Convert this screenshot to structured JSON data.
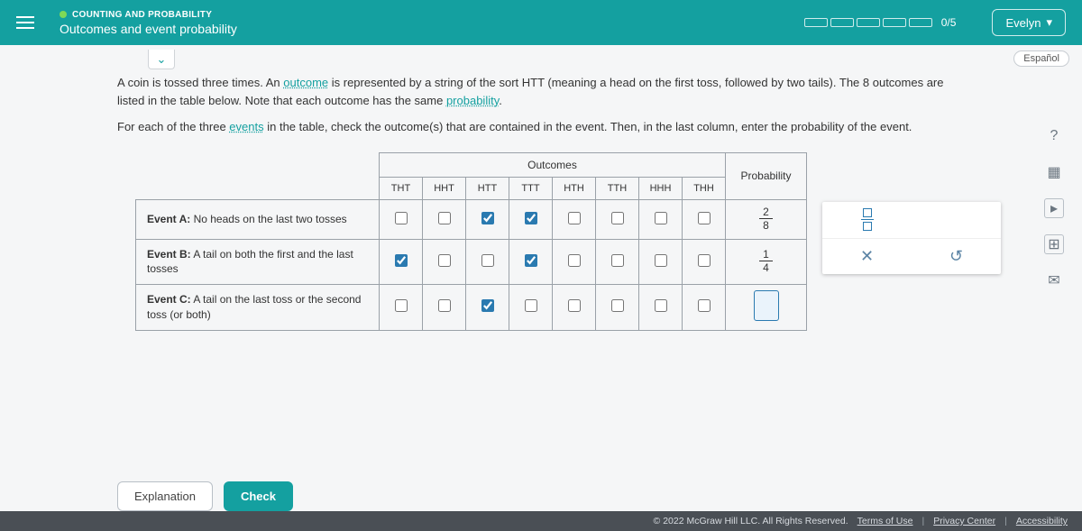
{
  "header": {
    "chapter": "COUNTING AND PROBABILITY",
    "lesson": "Outcomes and event probability",
    "progress": "0/5",
    "user": "Evelyn"
  },
  "toolbar": {
    "language": "Español"
  },
  "question": {
    "p1_a": "A coin is tossed three times. An ",
    "p1_link1": "outcome",
    "p1_b": " is represented by a string of the sort HTT (meaning a head on the first toss, followed by two tails). The 8 outcomes are listed in the table below. Note that each outcome has the same ",
    "p1_link2": "probability",
    "p1_c": ".",
    "p2_a": "For each of the three ",
    "p2_link": "events",
    "p2_b": " in the table, check the outcome(s) that are contained in the event. Then, in the last column, enter the probability of the event."
  },
  "table": {
    "outcomes_header": "Outcomes",
    "probability_header": "Probability",
    "outcome_labels": [
      "THT",
      "HHT",
      "HTT",
      "TTT",
      "HTH",
      "TTH",
      "HHH",
      "THH"
    ],
    "rows": [
      {
        "label_bold": "Event A:",
        "label_rest": " No heads on the last two tosses",
        "checks": [
          false,
          false,
          true,
          true,
          false,
          false,
          false,
          false
        ],
        "prob_num": "2",
        "prob_den": "8",
        "prob_type": "frac"
      },
      {
        "label_bold": "Event B:",
        "label_rest": " A tail on both the first and the last tosses",
        "checks": [
          true,
          false,
          false,
          true,
          false,
          false,
          false,
          false
        ],
        "prob_num": "1",
        "prob_den": "4",
        "prob_type": "frac"
      },
      {
        "label_bold": "Event C:",
        "label_rest": " A tail on the last toss or the second toss (or both)",
        "checks": [
          false,
          false,
          true,
          false,
          false,
          false,
          false,
          false
        ],
        "prob_type": "input"
      }
    ]
  },
  "palette": {
    "cross": "✕",
    "undo": "↺"
  },
  "side": {
    "help": "?",
    "calc": "▦",
    "play": "▸",
    "grid": "⊞",
    "mail": "✉"
  },
  "buttons": {
    "explanation": "Explanation",
    "check": "Check"
  },
  "footer": {
    "copyright": "© 2022 McGraw Hill LLC. All Rights Reserved.",
    "terms": "Terms of Use",
    "privacy": "Privacy Center",
    "accessibility": "Accessibility"
  }
}
